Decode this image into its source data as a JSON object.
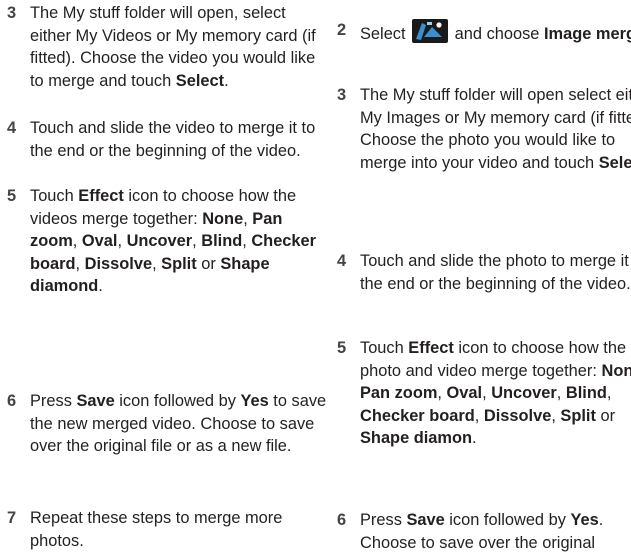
{
  "left_column": {
    "step3": {
      "num": "3",
      "t1": "The My stuff folder will open, select either My Videos or My memory card (if fitted). Choose the video you would like to merge and touch ",
      "b1": "Select",
      "t2": "."
    },
    "step4": {
      "num": "4",
      "t1": "Touch and slide the video to merge it to the end or the beginning of the video."
    },
    "step5": {
      "num": "5",
      "t1": "Touch ",
      "b1": "Effect",
      "t2": " icon to choose how the videos merge together: ",
      "o1": "None",
      "o2": "Pan zoom",
      "o3": "Oval",
      "o4": "Uncover",
      "o5": "Blind",
      "o6": "Checker board",
      "o7": "Dissolve",
      "o8": "Split",
      "or": " or ",
      "o9": "Shape diamond",
      "end": "."
    },
    "step6": {
      "num": "6",
      "t1": "Press ",
      "b1": "Save",
      "t2": " icon followed by ",
      "b2": "Yes",
      "t3": " to save the new merged video. Choose to save over the original file or as a new file."
    },
    "step7": {
      "num": "7",
      "t1": "Repeat these steps to merge more photos."
    }
  },
  "right_column": {
    "step2": {
      "num": "2",
      "t1": "Select ",
      "icon": "image-merge-tools-icon",
      "t2": " and choose ",
      "b1": "Image merge",
      "t3": "."
    },
    "step3": {
      "num": "3",
      "t1": "The My stuff folder will open select either My Images or My memory card (if fitted). Choose the photo you would like to merge into your video and touch ",
      "b1": "Select",
      "t2": "."
    },
    "step4": {
      "num": "4",
      "t1": "Touch and slide the photo to merge it to the end or the beginning of the video."
    },
    "step5": {
      "num": "5",
      "t1": "Touch ",
      "b1": "Effect",
      "t2": " icon to choose how the photo and video merge together: ",
      "o1": "None",
      "o2": "Pan zoom",
      "o3": "Oval",
      "o4": "Uncover",
      "o5": "Blind",
      "o6": "Checker board",
      "o7": "Dissolve",
      "o8": "Split",
      "or": " or ",
      "o9": "Shape diamon",
      "end": "."
    },
    "step6": {
      "num": "6",
      "t1": "Press ",
      "b1": "Save",
      "t2": " icon followed by ",
      "b2": "Yes",
      "t3": ". Choose to save over the original"
    }
  },
  "colors": {
    "text": "#231f20",
    "number": "#444444",
    "icon_bg": "#1a1a1a",
    "icon_accent": "#3a8fd0"
  }
}
